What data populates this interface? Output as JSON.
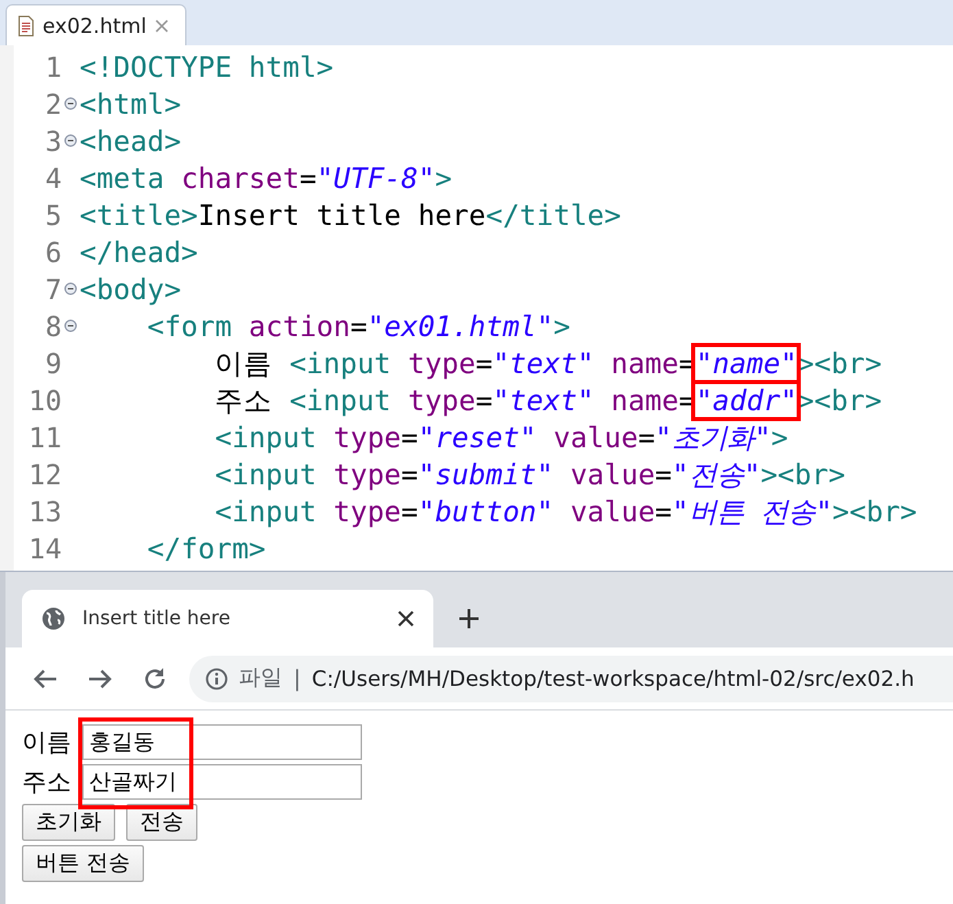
{
  "editor": {
    "tab": {
      "label": "ex02.html",
      "selected": true
    },
    "lines": [
      {
        "number": "1",
        "foldable": false,
        "tokens": [
          {
            "kind": "tag",
            "text": "<!DOCTYPE html>"
          }
        ]
      },
      {
        "number": "2",
        "foldable": true,
        "tokens": [
          {
            "kind": "tag",
            "text": "<html>"
          }
        ]
      },
      {
        "number": "3",
        "foldable": true,
        "tokens": [
          {
            "kind": "tag",
            "text": "<head>"
          }
        ]
      },
      {
        "number": "4",
        "foldable": false,
        "tokens": [
          {
            "kind": "tag",
            "text": "<meta "
          },
          {
            "kind": "attr",
            "text": "charset"
          },
          {
            "kind": "eq",
            "text": "="
          },
          {
            "kind": "val",
            "text": "\"UTF-8\""
          },
          {
            "kind": "tag",
            "text": ">"
          }
        ]
      },
      {
        "number": "5",
        "foldable": false,
        "tokens": [
          {
            "kind": "tag",
            "text": "<title>"
          },
          {
            "kind": "text",
            "text": "Insert title here"
          },
          {
            "kind": "tag",
            "text": "</title>"
          }
        ]
      },
      {
        "number": "6",
        "foldable": false,
        "tokens": [
          {
            "kind": "tag",
            "text": "</head>"
          }
        ]
      },
      {
        "number": "7",
        "foldable": true,
        "tokens": [
          {
            "kind": "tag",
            "text": "<body>"
          }
        ]
      },
      {
        "number": "8",
        "foldable": true,
        "tokens": [
          {
            "kind": "tag",
            "text": "    <form "
          },
          {
            "kind": "attr",
            "text": "action"
          },
          {
            "kind": "eq",
            "text": "="
          },
          {
            "kind": "val",
            "text": "\"ex01.html\""
          },
          {
            "kind": "tag",
            "text": ">"
          }
        ]
      },
      {
        "number": "9",
        "foldable": false,
        "tokens": [
          {
            "kind": "text",
            "text": "        이름 "
          },
          {
            "kind": "tag",
            "text": "<input "
          },
          {
            "kind": "attr",
            "text": "type"
          },
          {
            "kind": "eq",
            "text": "="
          },
          {
            "kind": "val",
            "text": "\"text\""
          },
          {
            "kind": "attr",
            "text": " name"
          },
          {
            "kind": "eq",
            "text": "="
          },
          {
            "kind": "val",
            "text": "\"name\"",
            "highlighted": true
          },
          {
            "kind": "tag",
            "text": "><br>"
          }
        ]
      },
      {
        "number": "10",
        "foldable": false,
        "tokens": [
          {
            "kind": "text",
            "text": "        주소 "
          },
          {
            "kind": "tag",
            "text": "<input "
          },
          {
            "kind": "attr",
            "text": "type"
          },
          {
            "kind": "eq",
            "text": "="
          },
          {
            "kind": "val",
            "text": "\"text\""
          },
          {
            "kind": "attr",
            "text": " name"
          },
          {
            "kind": "eq",
            "text": "="
          },
          {
            "kind": "val",
            "text": "\"addr\"",
            "highlighted": true
          },
          {
            "kind": "tag",
            "text": "><br>"
          }
        ]
      },
      {
        "number": "11",
        "foldable": false,
        "tokens": [
          {
            "kind": "tag",
            "text": "        <input "
          },
          {
            "kind": "attr",
            "text": "type"
          },
          {
            "kind": "eq",
            "text": "="
          },
          {
            "kind": "val",
            "text": "\"reset\""
          },
          {
            "kind": "attr",
            "text": " value"
          },
          {
            "kind": "eq",
            "text": "="
          },
          {
            "kind": "val",
            "text": "\"초기화\""
          },
          {
            "kind": "tag",
            "text": ">"
          }
        ]
      },
      {
        "number": "12",
        "foldable": false,
        "tokens": [
          {
            "kind": "tag",
            "text": "        <input "
          },
          {
            "kind": "attr",
            "text": "type"
          },
          {
            "kind": "eq",
            "text": "="
          },
          {
            "kind": "val",
            "text": "\"submit\""
          },
          {
            "kind": "attr",
            "text": " value"
          },
          {
            "kind": "eq",
            "text": "="
          },
          {
            "kind": "val",
            "text": "\"전송\""
          },
          {
            "kind": "tag",
            "text": "><br>"
          }
        ]
      },
      {
        "number": "13",
        "foldable": false,
        "tokens": [
          {
            "kind": "tag",
            "text": "        <input "
          },
          {
            "kind": "attr",
            "text": "type"
          },
          {
            "kind": "eq",
            "text": "="
          },
          {
            "kind": "val",
            "text": "\"button\""
          },
          {
            "kind": "attr",
            "text": " value"
          },
          {
            "kind": "eq",
            "text": "="
          },
          {
            "kind": "val",
            "text": "\"버튼 전송\""
          },
          {
            "kind": "tag",
            "text": "><br>"
          }
        ]
      },
      {
        "number": "14",
        "foldable": false,
        "tokens": [
          {
            "kind": "tag",
            "text": "    </form>"
          }
        ]
      }
    ]
  },
  "browser": {
    "tab": {
      "title": "Insert title here",
      "selected": true
    },
    "address": {
      "scheme": "파일",
      "separator": "|",
      "url": "C:/Users/MH/Desktop/test-workspace/html-02/src/ex02.h"
    },
    "page": {
      "highlighted": true,
      "fields": [
        {
          "label": "이름",
          "value": "홍길동"
        },
        {
          "label": "주소",
          "value": "산골짜기"
        }
      ],
      "button_rows": [
        {
          "buttons": [
            "초기화",
            "전송"
          ]
        },
        {
          "buttons": [
            "버튼 전송"
          ]
        }
      ]
    }
  }
}
